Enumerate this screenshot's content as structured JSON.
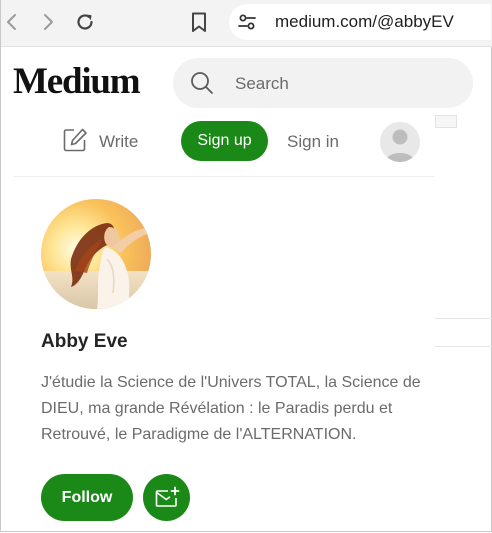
{
  "browser": {
    "url": "medium.com/@abbyEV",
    "icons": [
      "back-icon",
      "forward-icon",
      "reload-icon",
      "bookmark-icon",
      "site-settings-icon"
    ]
  },
  "header": {
    "logo": "Medium",
    "search_placeholder": "Search",
    "write_label": "Write",
    "signup_label": "Sign up",
    "signin_label": "Sign in"
  },
  "profile": {
    "name": "Abby Eve",
    "bio": "J'étudie la Science de l'Univers TOTAL, la Science de DIEU, ma grande Révélation : le Paradis perdu et Retrouvé, le Paradigme de l'ALTERNATION.",
    "follow_label": "Follow"
  },
  "colors": {
    "accent_green": "#1a8917",
    "text_primary": "#242424",
    "text_secondary": "#6b6b6b",
    "search_bg": "#f2f2f2"
  }
}
